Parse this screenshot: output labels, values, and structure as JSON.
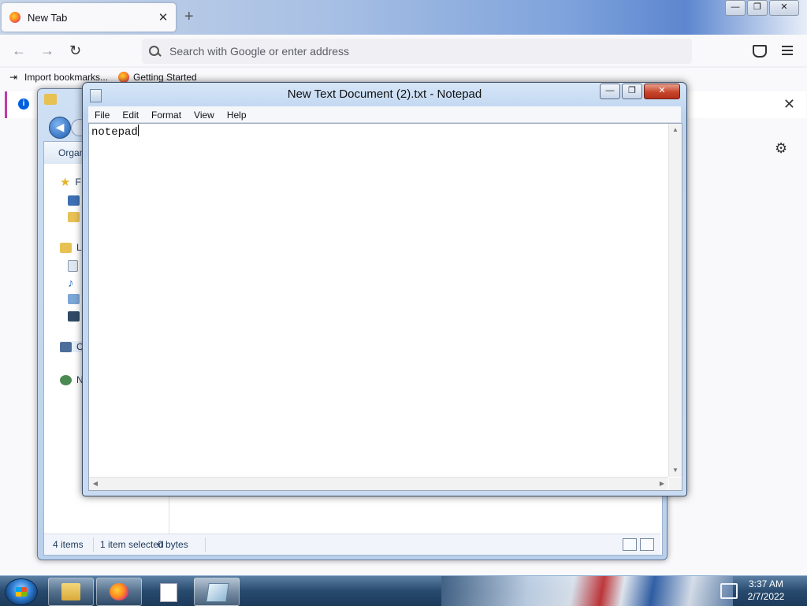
{
  "firefox": {
    "tab_title": "New Tab",
    "tab_close": "✕",
    "new_tab": "+",
    "url_placeholder": "Search with Google or enter address",
    "bookmarks": [
      {
        "label": "Import bookmarks..."
      },
      {
        "label": "Getting Started"
      }
    ],
    "info_close": "✕",
    "window_buttons": {
      "minimize": "—",
      "restore": "❐",
      "close": "✕"
    }
  },
  "explorer": {
    "organize": "Organ",
    "nav_items": [
      "F",
      "Li",
      "C",
      "N"
    ],
    "status": {
      "items": "4 items",
      "selected": "1 item selected",
      "size": "0 bytes"
    }
  },
  "notepad": {
    "title": "New Text Document (2).txt - Notepad",
    "menu": [
      "File",
      "Edit",
      "Format",
      "View",
      "Help"
    ],
    "content": "notepad",
    "buttons": {
      "minimize": "—",
      "maximize": "❐",
      "close": "✕"
    }
  },
  "taskbar": {
    "time": "3:37 AM",
    "date": "2/7/2022"
  }
}
